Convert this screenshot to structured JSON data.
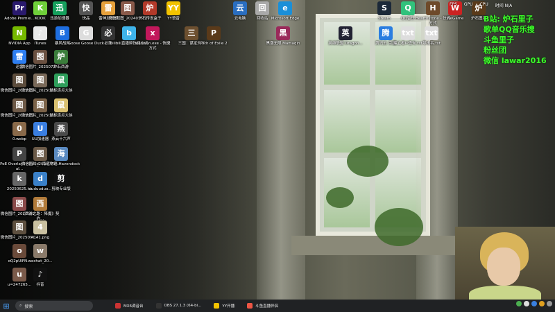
{
  "desktop_icons": [
    {
      "label": "Adobe Premie...",
      "color": "#2a1a6e",
      "glyph": "Pr"
    },
    {
      "label": "KOOK",
      "color": "#6fcf3a",
      "glyph": "K"
    },
    {
      "label": "迅游加速器",
      "color": "#16a05d",
      "glyph": "迅"
    },
    {
      "label": "快品",
      "color": "#555",
      "glyph": "快"
    },
    {
      "label": "雷神加速器",
      "color": "#e6a13c",
      "glyph": "雷"
    },
    {
      "label": "微信截图_2024071...",
      "color": "#8a5a4a",
      "glyph": "图"
    },
    {
      "label": "炉石传说盒子",
      "color": "#b33a2a",
      "glyph": "炉"
    },
    {
      "label": "YY语音",
      "color": "#f3c300",
      "glyph": "YY"
    },
    {
      "label": "NVIDIA App",
      "color": "#76b900",
      "glyph": "N"
    },
    {
      "label": "iTunes",
      "color": "#e8e8e8",
      "glyph": "♪"
    },
    {
      "label": "暴风战网",
      "color": "#1e6ee0",
      "glyph": "B"
    },
    {
      "label": "Goose Goose Duck",
      "color": "#ddd",
      "glyph": "G"
    },
    {
      "label": "必剪",
      "color": "#333",
      "glyph": "必"
    },
    {
      "label": "bilibili直播姬快捷方式",
      "color": "#3fb4ea",
      "glyph": "b"
    },
    {
      "label": "xiaowan.exe - 快捷方式",
      "color": "#c2185b",
      "glyph": "x"
    },
    {
      "label": "三国：谋定天下",
      "color": "#6d5030",
      "glyph": "三"
    },
    {
      "label": "Path of Exile 2",
      "color": "#5a3a1a",
      "glyph": "P"
    },
    {
      "label": "迅雷",
      "color": "#2e7ef0",
      "glyph": "雷"
    },
    {
      "label": "微信图片_2025072...",
      "color": "#6a5040",
      "glyph": "图"
    },
    {
      "label": "炉石西游",
      "color": "#3b7d3b",
      "glyph": "炉"
    },
    {
      "label": "微信图片_2025020...",
      "color": "#5d4d3d",
      "glyph": "图"
    },
    {
      "label": "微信图片_2025072...",
      "color": "#7a6a5a",
      "glyph": "图"
    },
    {
      "label": "鼠标连点大侠",
      "color": "#2e9e5b",
      "glyph": "鼠"
    },
    {
      "label": "微信图片_2025072...",
      "color": "#6e5a48",
      "glyph": "图"
    },
    {
      "label": "微信图片_2025072...",
      "color": "#7b6349",
      "glyph": "图"
    },
    {
      "label": "鼠标连点大侠",
      "color": "#d9c070",
      "glyph": "鼠"
    },
    {
      "label": "0.webp",
      "color": "#8a6a4a",
      "glyph": "0"
    },
    {
      "label": "UU加速器",
      "color": "#3a7ee0",
      "glyph": "U"
    },
    {
      "label": "燕云十六声",
      "color": "#4a4a4a",
      "glyph": "燕"
    },
    {
      "label": "PoE Overlay II Standal...",
      "color": "#444",
      "glyph": "P"
    },
    {
      "label": "微信图片_2025073...",
      "color": "#6b5a48",
      "glyph": "图"
    },
    {
      "label": "海道物语 Havendock",
      "color": "#5a8ac0",
      "glyph": "海"
    },
    {
      "label": "20250625.kx",
      "color": "#666",
      "glyph": "k"
    },
    {
      "label": "duduuduo...",
      "color": "#3a80c8",
      "glyph": "d"
    },
    {
      "label": "剪映专业版",
      "color": "#111",
      "glyph": "剪"
    },
    {
      "label": "微信图片_2025062...",
      "color": "#8a4a4a",
      "glyph": "图"
    },
    {
      "label": "《西游之路：降魔》契约...",
      "color": "#b07a3a",
      "glyph": "西"
    },
    {
      "label": "微信图片_2025091...",
      "color": "#5e5040",
      "glyph": "图"
    },
    {
      "label": "4141.png",
      "color": "#c9c0a0",
      "glyph": "4"
    },
    {
      "label": "oQ2pUIFN...",
      "color": "#6a4a3a",
      "glyph": "o"
    },
    {
      "label": "wechat_20...",
      "color": "#8a7a6a",
      "glyph": "w"
    },
    {
      "label": "u=247265...",
      "color": "#7a5a4a",
      "glyph": "u"
    },
    {
      "label": "抖音",
      "color": "#111",
      "glyph": "♪"
    },
    {
      "label": "云电脑",
      "color": "#2a6ec0",
      "glyph": "云"
    },
    {
      "label": "回收站",
      "color": "#aaa",
      "glyph": "回"
    },
    {
      "label": "Microsoft Edge",
      "color": "#1a8fd8",
      "glyph": "e"
    },
    {
      "label": "Steam",
      "color": "#1b2838",
      "glyph": "S"
    },
    {
      "label": "QQ音乐",
      "color": "#31c27c",
      "glyph": "Q"
    },
    {
      "label": "Hearthstone - 快捷方式",
      "color": "#6e4a2a",
      "glyph": "H"
    },
    {
      "label": "WeGame",
      "color": "#c22",
      "glyph": "W"
    },
    {
      "label": "炉石图片",
      "color": "#5a3a1a",
      "glyph": "炉"
    },
    {
      "label": "黑潮无限 Mamaqin",
      "color": "#9a2a5a",
      "glyph": "黑"
    },
    {
      "label": "英雄联盟 Dragon...",
      "color": "#223",
      "glyph": "英"
    },
    {
      "label": "腾讯云 百度",
      "color": "#2a7de0",
      "glyph": "腾"
    },
    {
      "label": "建立者IP查询.txt",
      "color": "#ddd",
      "glyph": "txt"
    },
    {
      "label": "导出名.txt",
      "color": "#ddd",
      "glyph": "txt"
    }
  ],
  "overlay": {
    "line1": "B站: 炉石里子",
    "line2": "歌单QQ音乐搜",
    "line3": "斗鱼里子",
    "line4": "粉丝团",
    "line5": "微信  lawar2016"
  },
  "topbar": {
    "fps": "FPS",
    "gpu": "GPU",
    "cpu": "CPU",
    "time_label": "时间 N/A"
  },
  "taskbar": {
    "search_placeholder": "搜索",
    "items": [
      {
        "label": "MX6调音台",
        "color": "#c33"
      },
      {
        "label": "OBS 27.1.3 (64-bi...",
        "color": "#333"
      },
      {
        "label": "YY开播",
        "color": "#f3c300"
      },
      {
        "label": "斗鱼直播伴侣",
        "color": "#e54"
      }
    ]
  }
}
